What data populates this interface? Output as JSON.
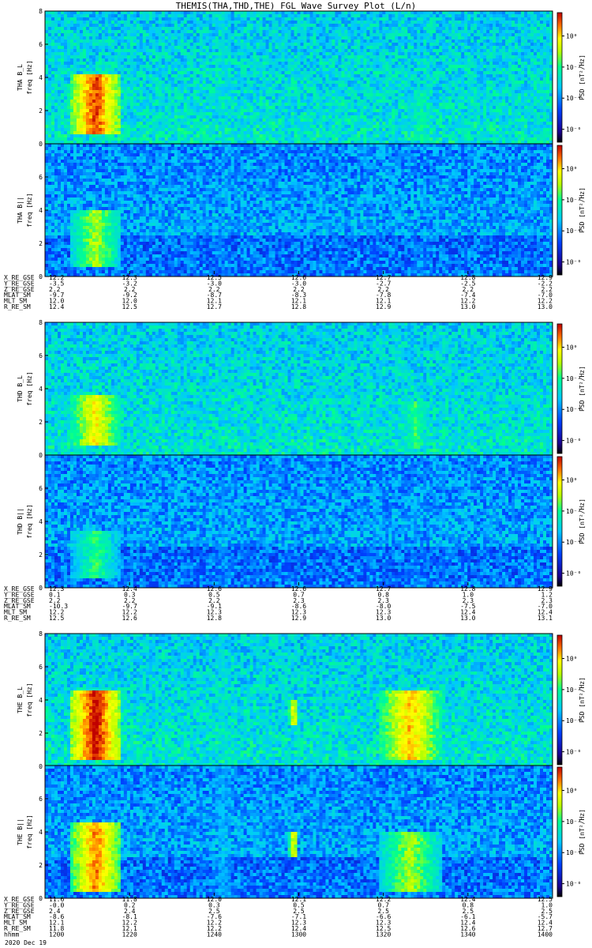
{
  "title": "THEMIS(THA,THD,THE) FGL Wave Survey Plot (L/n)",
  "date_label": "2020 Dec 19",
  "colorbar_label": "PSD [nT²/Hz]",
  "chart_data": [
    {
      "type": "heatmap",
      "probe": "THA",
      "panels": [
        {
          "ylabel": "THA B_L",
          "sublabel": "freq [Hz]",
          "yticks": [
            "0",
            "2",
            "4",
            "6",
            "8"
          ],
          "ylim": [
            0,
            8
          ],
          "colorbar_ticks": [
            "10⁰",
            "10⁻²",
            "10⁻⁴",
            "10⁻⁶"
          ],
          "features": [
            {
              "t": 0.1,
              "w": 0.05,
              "f0": 0.5,
              "f1": 4.2,
              "level": 0.95
            },
            {
              "t": 0.35,
              "w": 0.02,
              "f0": 0.0,
              "f1": 8.0,
              "level": 0.45
            },
            {
              "t": 0.74,
              "w": 0.03,
              "f0": 0.3,
              "f1": 3.0,
              "level": 0.55
            }
          ]
        },
        {
          "ylabel": "THA B||",
          "sublabel": "freq [Hz]",
          "yticks": [
            "0",
            "2",
            "4",
            "6"
          ],
          "ylim": [
            0,
            8
          ],
          "colorbar_ticks": [
            "10⁰",
            "10⁻²",
            "10⁻⁴",
            "10⁻⁶"
          ],
          "features": [
            {
              "t": 0.1,
              "w": 0.05,
              "f0": 0.5,
              "f1": 4.0,
              "level": 0.7
            },
            {
              "t": 0.35,
              "w": 0.02,
              "f0": 0.0,
              "f1": 8.0,
              "level": 0.3
            },
            {
              "t": 0.74,
              "w": 0.03,
              "f0": 0.0,
              "f1": 2.0,
              "level": 0.3
            }
          ]
        }
      ],
      "ephemeris": [
        {
          "label": "X_RE_GSE",
          "values": [
            "12.2",
            "12.3",
            "12.5",
            "12.6",
            "12.7",
            "12.8",
            "12.9"
          ]
        },
        {
          "label": "Y_RE_GSE",
          "values": [
            "-3.5",
            "-3.2",
            "-3.0",
            "-3.0",
            "-2.7",
            "-2.5",
            "-2.2"
          ]
        },
        {
          "label": "Z_RE_GSE",
          "values": [
            "2.2",
            "2.2",
            "2.2",
            "2.2",
            "2.2",
            "2.2",
            "2.2"
          ]
        },
        {
          "label": "MLAT_SM",
          "values": [
            "-9.7",
            "-9.2",
            "-8.7",
            "-8.3",
            "-7.8",
            "-7.4",
            "-7.0"
          ]
        },
        {
          "label": "MLT_SM",
          "values": [
            "12.0",
            "12.0",
            "12.1",
            "12.1",
            "12.1",
            "12.2",
            "12.2"
          ]
        },
        {
          "label": "R_RE_SM",
          "values": [
            "12.4",
            "12.5",
            "12.7",
            "12.8",
            "12.9",
            "13.0",
            "13.0"
          ]
        }
      ]
    },
    {
      "type": "heatmap",
      "probe": "THD",
      "panels": [
        {
          "ylabel": "THD B_L",
          "sublabel": "freq [Hz]",
          "yticks": [
            "0",
            "2",
            "4",
            "6",
            "8"
          ],
          "ylim": [
            0,
            8
          ],
          "colorbar_ticks": [
            "10⁰",
            "10⁻²",
            "10⁻⁴",
            "10⁻⁶"
          ],
          "features": [
            {
              "t": 0.1,
              "w": 0.05,
              "f0": 0.5,
              "f1": 3.6,
              "level": 0.8
            },
            {
              "t": 0.35,
              "w": 0.02,
              "f0": 0.0,
              "f1": 8.0,
              "level": 0.4
            },
            {
              "t": 0.73,
              "w": 0.03,
              "f0": 0.3,
              "f1": 3.2,
              "level": 0.6
            }
          ]
        },
        {
          "ylabel": "THD B||",
          "sublabel": "freq [Hz]",
          "yticks": [
            "0",
            "2",
            "4",
            "6"
          ],
          "ylim": [
            0,
            8
          ],
          "colorbar_ticks": [
            "10⁰",
            "10⁻²",
            "10⁻⁴",
            "10⁻⁶"
          ],
          "features": [
            {
              "t": 0.1,
              "w": 0.05,
              "f0": 0.5,
              "f1": 3.5,
              "level": 0.6
            },
            {
              "t": 0.35,
              "w": 0.02,
              "f0": 0.0,
              "f1": 8.0,
              "level": 0.3
            },
            {
              "t": 0.73,
              "w": 0.03,
              "f0": 0.0,
              "f1": 2.0,
              "level": 0.3
            }
          ]
        }
      ],
      "ephemeris": [
        {
          "label": "X_RE_GSE",
          "values": [
            "12.3",
            "12.4",
            "12.6",
            "12.6",
            "12.7",
            "12.8",
            "12.9"
          ]
        },
        {
          "label": "Y_RE_GSE",
          "values": [
            "0.1",
            "0.3",
            "0.5",
            "0.7",
            "0.8",
            "1.0",
            "1.2"
          ]
        },
        {
          "label": "Z_RE_GSE",
          "values": [
            "2.2",
            "2.2",
            "2.2",
            "2.3",
            "2.3",
            "2.3",
            "2.3"
          ]
        },
        {
          "label": "MLAT_SM",
          "values": [
            "-10.3",
            "-9.7",
            "-9.1",
            "-8.6",
            "-8.0",
            "-7.5",
            "-7.0"
          ]
        },
        {
          "label": "MLT_SM",
          "values": [
            "12.2",
            "12.2",
            "12.3",
            "12.3",
            "12.3",
            "12.4",
            "12.4"
          ]
        },
        {
          "label": "R_RE_SM",
          "values": [
            "12.5",
            "12.6",
            "12.8",
            "12.9",
            "13.0",
            "13.0",
            "13.1"
          ]
        }
      ]
    },
    {
      "type": "heatmap",
      "probe": "THE",
      "panels": [
        {
          "ylabel": "THE B_L",
          "sublabel": "freq [Hz]",
          "yticks": [
            "0",
            "2",
            "4",
            "6",
            "8"
          ],
          "ylim": [
            0,
            8
          ],
          "colorbar_ticks": [
            "10⁰",
            "10⁻²",
            "10⁻⁴",
            "10⁻⁶"
          ],
          "features": [
            {
              "t": 0.1,
              "w": 0.05,
              "f0": 0.3,
              "f1": 4.6,
              "level": 1.0
            },
            {
              "t": 0.35,
              "w": 0.02,
              "f0": 0.0,
              "f1": 8.0,
              "level": 0.45
            },
            {
              "t": 0.49,
              "w": 0.01,
              "f0": 2.5,
              "f1": 4.0,
              "level": 0.8
            },
            {
              "t": 0.72,
              "w": 0.06,
              "f0": 0.3,
              "f1": 4.5,
              "level": 0.85
            }
          ]
        },
        {
          "ylabel": "THE B||",
          "sublabel": "freq [Hz]",
          "yticks": [
            "0",
            "2",
            "4",
            "6"
          ],
          "ylim": [
            0,
            8
          ],
          "colorbar_ticks": [
            "10⁰",
            "10⁻²",
            "10⁻⁴",
            "10⁻⁶"
          ],
          "features": [
            {
              "t": 0.1,
              "w": 0.05,
              "f0": 0.3,
              "f1": 4.6,
              "level": 0.9
            },
            {
              "t": 0.35,
              "w": 0.02,
              "f0": 0.0,
              "f1": 8.0,
              "level": 0.4
            },
            {
              "t": 0.49,
              "w": 0.01,
              "f0": 2.5,
              "f1": 4.0,
              "level": 0.8
            },
            {
              "t": 0.72,
              "w": 0.06,
              "f0": 0.3,
              "f1": 4.0,
              "level": 0.7
            }
          ]
        }
      ],
      "ephemeris": [
        {
          "label": "X_RE_GSE",
          "values": [
            "11.6",
            "11.8",
            "12.0",
            "12.1",
            "12.2",
            "12.4",
            "12.5"
          ]
        },
        {
          "label": "Y_RE_GSE",
          "values": [
            "-0.0",
            "0.2",
            "0.3",
            "0.5",
            "0.7",
            "0.8",
            "1.0"
          ]
        },
        {
          "label": "Z_RE_GSE",
          "values": [
            "2.4",
            "2.4",
            "2.5",
            "2.5",
            "2.5",
            "2.5",
            "2.5"
          ]
        },
        {
          "label": "MLAT_SM",
          "values": [
            "-8.6",
            "-8.1",
            "-7.6",
            "-7.1",
            "-6.6",
            "-6.1",
            "-5.7"
          ]
        },
        {
          "label": "MLT_SM",
          "values": [
            "12.1",
            "12.2",
            "12.2",
            "12.3",
            "12.3",
            "12.4",
            "12.4"
          ]
        },
        {
          "label": "R_RE_SM",
          "values": [
            "11.8",
            "12.1",
            "12.2",
            "12.4",
            "12.5",
            "12.6",
            "12.7"
          ]
        },
        {
          "label": "hhmm",
          "values": [
            "1200",
            "1220",
            "1240",
            "1300",
            "1320",
            "1340",
            "1400"
          ]
        }
      ]
    }
  ]
}
